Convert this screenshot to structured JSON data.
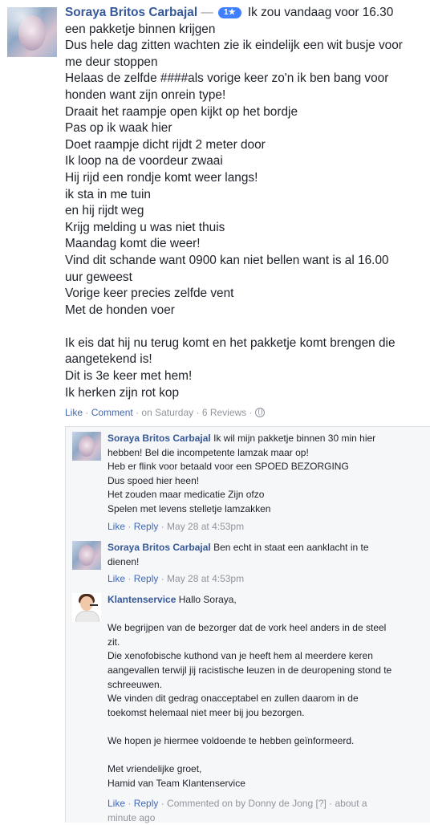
{
  "post": {
    "author": "Soraya Britos Carbajal",
    "dash": "—",
    "badge": "1★",
    "first_line": "Ik zou vandaag voor 16.30",
    "lines": [
      "een pakketje binnen krijgen",
      "Dus hele dag zitten wachten zie ik eindelijk een wit busje voor",
      "me deur stoppen",
      "Helaas de zelfde ####als vorige keer zo'n ik ben bang voor",
      "honden want zijn onrein type!",
      "Draait het raampje open kijkt op het bordje",
      "Pas op ik waak hier",
      "Doet raampje dicht rijdt 2 meter door",
      "Ik loop na de voordeur zwaai",
      "Hij rijd een rondje komt weer langs!",
      "ik sta in me tuin",
      "en hij rijdt weg",
      "Krijg melding u was niet thuis",
      "Maandag komt die weer!",
      "Vind dit schande want 0900 kan niet bellen want is al 16.00",
      "uur geweest",
      "Vorige keer precies zelfde vent",
      "Met de honden voer",
      "",
      "Ik eis dat hij nu terug komt en het pakketje komt brengen die",
      "aangetekend is!",
      "Dit is 3e keer met hem!",
      "Ik herken zijn rot kop"
    ],
    "actions": {
      "like": "Like",
      "sep": "·",
      "comment": "Comment",
      "time": "on Saturday",
      "reviews": "6 Reviews"
    }
  },
  "replies": [
    {
      "author": "Soraya Britos Carbajal",
      "first": "Ik wil mijn pakketje binnen 30 min hier",
      "lines": [
        "hebben! Bel die incompetente lamzak maar op!",
        "Heb er flink voor betaald voor een SPOED BEZORGING",
        "Dus spoed hier heen!",
        "Het zouden maar medicatie Zijn ofzo",
        "Spelen met levens stelletje lamzakken"
      ],
      "like": "Like",
      "reply": "Reply",
      "time": "May 28 at 4:53pm"
    },
    {
      "author": "Soraya Britos Carbajal",
      "first": "Ben echt in staat een aanklacht in te",
      "lines": [
        "dienen!"
      ],
      "like": "Like",
      "reply": "Reply",
      "time": "May 28 at 4:53pm"
    },
    {
      "author": "Klantenservice",
      "first": "Hallo Soraya,",
      "lines": [
        "",
        "We begrijpen van de bezorger dat de vork heel anders in de steel",
        "zit.",
        "Die xenofobische kuthond van je heeft hem al meerdere keren",
        "aangevallen terwijl jij racistische leuzen in de deuropening stond te",
        "schreeuwen.",
        "We vinden dit gedrag onacceptabel en zullen daarom in de",
        "toekomst helemaal niet meer bij jou bezorgen.",
        "",
        "We hopen je hiermee voldoende te hebben geïnformeerd.",
        "",
        "Met vriendelijke groet,",
        "Hamid van Team Klantenservice"
      ],
      "like": "Like",
      "reply": "Reply",
      "time_line1": "Commented on by Donny de Jong [?] · about a",
      "time_line2": "minute ago"
    }
  ]
}
